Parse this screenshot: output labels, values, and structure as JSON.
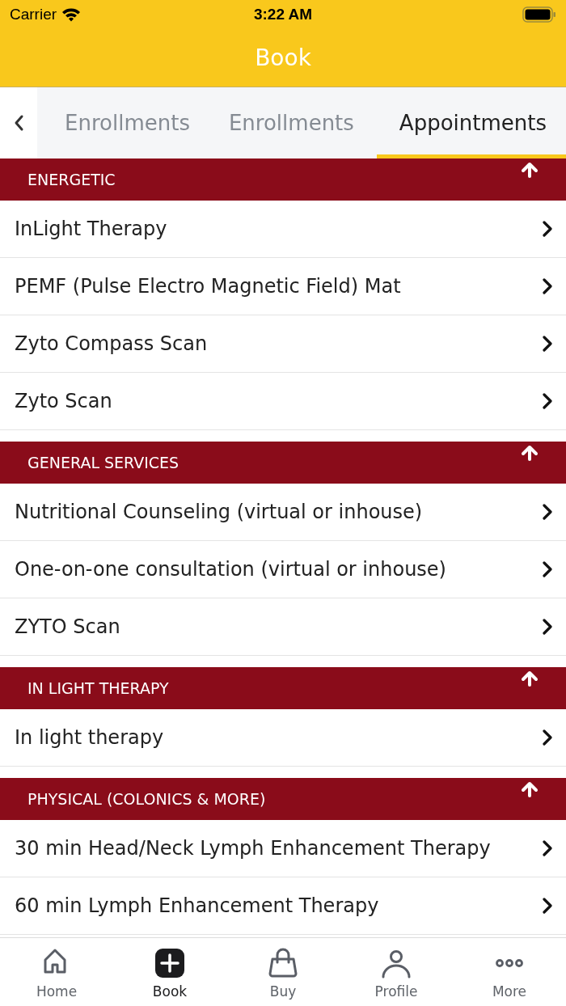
{
  "status_bar": {
    "carrier": "Carrier",
    "time": "3:22 AM"
  },
  "header": {
    "title": "Book"
  },
  "tabs": [
    {
      "label": "Enrollments",
      "selected": false
    },
    {
      "label": "Enrollments",
      "selected": false
    },
    {
      "label": "Appointments",
      "selected": true
    }
  ],
  "sections": [
    {
      "title": "ENERGETIC",
      "items": [
        "InLight Therapy",
        "PEMF (Pulse Electro Magnetic Field) Mat",
        "Zyto Compass Scan",
        "Zyto Scan"
      ]
    },
    {
      "title": "GENERAL SERVICES",
      "items": [
        "Nutritional Counseling (virtual or inhouse)",
        "One-on-one consultation (virtual or inhouse)",
        "ZYTO Scan"
      ]
    },
    {
      "title": "IN LIGHT THERAPY",
      "items": [
        "In light therapy"
      ]
    },
    {
      "title": "PHYSICAL (COLONICS & MORE)",
      "items": [
        "30 min Head/Neck Lymph Enhancement Therapy",
        "60 min Lymph Enhancement Therapy"
      ]
    }
  ],
  "tab_bar": [
    {
      "kind": "home",
      "label": "Home",
      "selected": false
    },
    {
      "kind": "book",
      "label": "Book",
      "selected": true
    },
    {
      "kind": "buy",
      "label": "Buy",
      "selected": false
    },
    {
      "kind": "profile",
      "label": "Profile",
      "selected": false
    },
    {
      "kind": "more",
      "label": "More",
      "selected": false
    }
  ]
}
